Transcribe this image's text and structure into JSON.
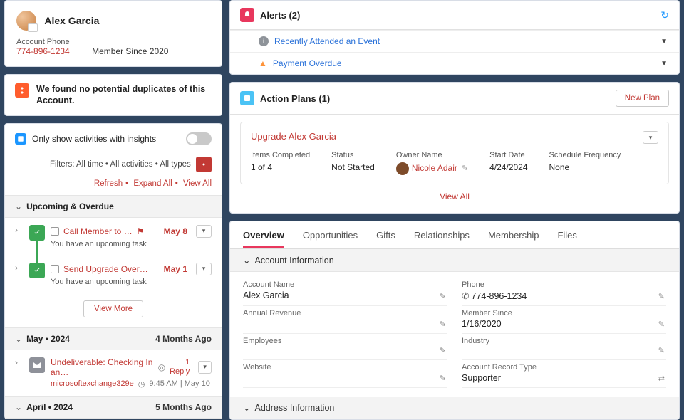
{
  "contact": {
    "name": "Alex Garcia",
    "account_phone_label": "Account Phone",
    "account_phone": "774-896-1234",
    "member_since": "Member Since 2020"
  },
  "duplicates": {
    "message": "We found no potential duplicates of this Account."
  },
  "activity": {
    "insights_label": "Only show activities with insights",
    "filters_text": "Filters: All time • All activities • All types",
    "refresh": "Refresh",
    "expand_all": "Expand All",
    "view_all": "View All",
    "upcoming_header": "Upcoming & Overdue",
    "items": [
      {
        "title": "Call Member to …",
        "flag": true,
        "date": "May 8",
        "sub": "You have an upcoming task"
      },
      {
        "title": "Send Upgrade Over…",
        "flag": false,
        "date": "May 1",
        "sub": "You have an upcoming task"
      }
    ],
    "view_more": "View More",
    "groups": [
      {
        "label": "May • 2024",
        "ago": "4 Months Ago"
      },
      {
        "label": "April • 2024",
        "ago": "5 Months Ago"
      }
    ],
    "email": {
      "title": "Undeliverable: Checking In an…",
      "reply_count": "1",
      "reply_label": "Reply",
      "from": "microsoftexchange329e",
      "time": "9:45 AM | May 10"
    }
  },
  "alerts": {
    "title": "Alerts (2)",
    "items": [
      {
        "type": "info",
        "text": "Recently Attended an Event"
      },
      {
        "type": "warn",
        "text": "Payment Overdue"
      }
    ]
  },
  "action_plans": {
    "title": "Action Plans (1)",
    "new_plan": "New Plan",
    "plan": {
      "name": "Upgrade Alex Garcia",
      "cols": {
        "items_label": "Items Completed",
        "items_value": "1 of 4",
        "status_label": "Status",
        "status_value": "Not Started",
        "owner_label": "Owner Name",
        "owner_value": "Nicole Adair",
        "start_label": "Start Date",
        "start_value": "4/24/2024",
        "freq_label": "Schedule Frequency",
        "freq_value": "None"
      }
    },
    "view_all": "View All"
  },
  "tabs": [
    "Overview",
    "Opportunities",
    "Gifts",
    "Relationships",
    "Membership",
    "Files"
  ],
  "details": {
    "account_info_header": "Account Information",
    "address_info_header": "Address Information",
    "fields": {
      "account_name_label": "Account Name",
      "account_name": "Alex Garcia",
      "phone_label": "Phone",
      "phone": "774-896-1234",
      "annual_rev_label": "Annual Revenue",
      "annual_rev": "",
      "member_since_label": "Member Since",
      "member_since": "1/16/2020",
      "employees_label": "Employees",
      "employees": "",
      "industry_label": "Industry",
      "industry": "",
      "website_label": "Website",
      "website": "",
      "record_type_label": "Account Record Type",
      "record_type": "Supporter"
    }
  }
}
